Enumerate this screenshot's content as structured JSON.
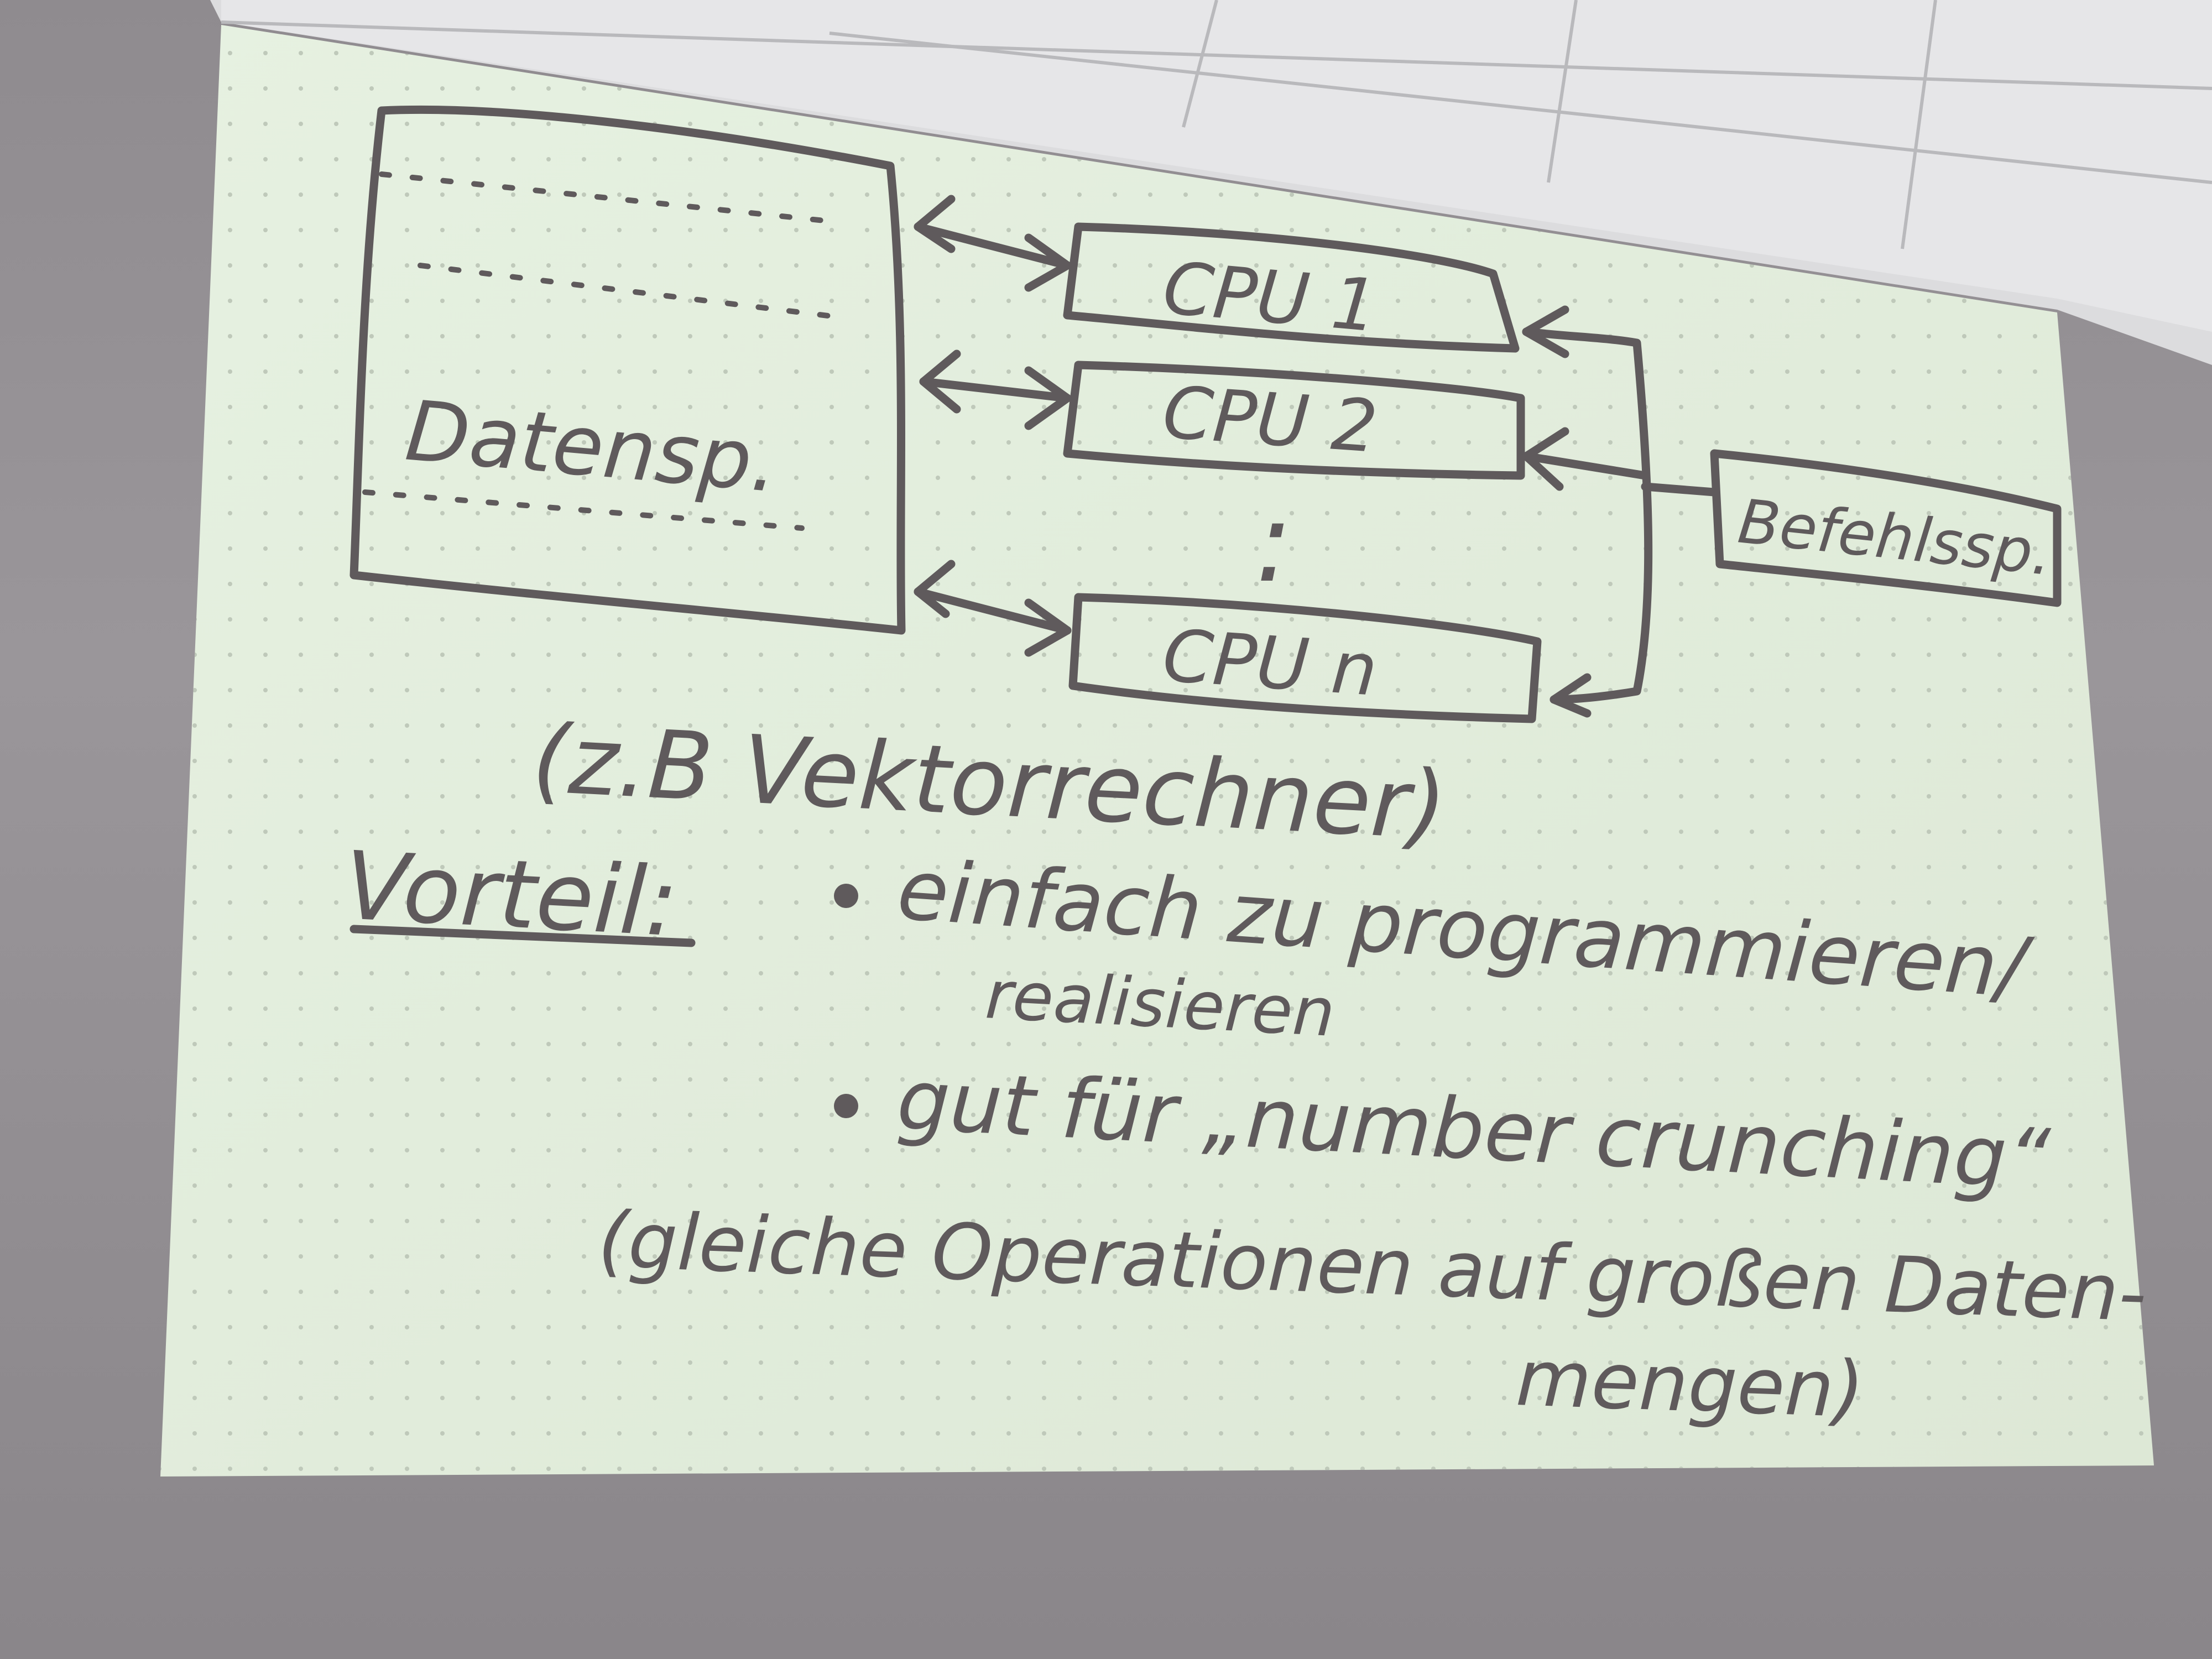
{
  "diagram": {
    "memory_label": "Datensp.",
    "cpus": [
      "CPU 1",
      "CPU 2",
      "CPU n"
    ],
    "ellipsis": ":",
    "instruction_memory_label": "Befehlssp."
  },
  "notes": {
    "example": "(z.B Vektorrechner)",
    "advantage_heading": "Vorteil:",
    "bullet1_line1": "einfach zu programmieren/",
    "bullet1_line2": "realisieren",
    "bullet2": "gut für „number crunching“",
    "paren_line1": "(gleiche Operationen auf großen Daten-",
    "paren_line2": "mengen)"
  },
  "colors": {
    "ink": "#5f5a5c",
    "screen": "#e3eedd",
    "wall": "#948f93",
    "ceiling": "#e2e2e4"
  }
}
